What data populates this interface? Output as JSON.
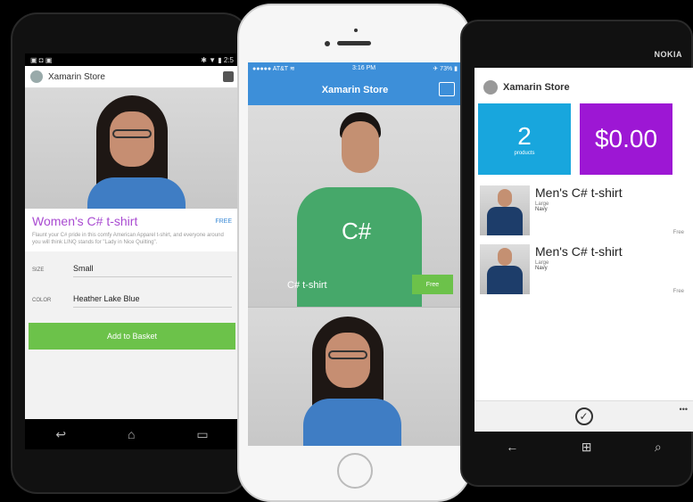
{
  "android": {
    "status": {
      "left": "▣ ◘ ▣",
      "right": "✱ ▼ ▮ 2:5"
    },
    "app_title": "Xamarin Store",
    "product_name": "Women's C# t-shirt",
    "price": "FREE",
    "description": "Flaunt your C# pride in this comfy American Apparel t-shirt, and everyone around you will think LINQ stands for \"Lady in Nice Quilting\".",
    "size_label": "SIZE",
    "size_value": "Small",
    "color_label": "COLOR",
    "color_value": "Heather Lake Blue",
    "add_button": "Add to Basket",
    "nav": {
      "back": "↩",
      "home": "⌂",
      "recent": "▭"
    }
  },
  "iphone": {
    "status": {
      "carrier": "●●●●● AT&T ≋",
      "time": "3:16 PM",
      "battery": "✈ 73% ▮"
    },
    "app_title": "Xamarin Store",
    "card1_logo": "C#",
    "card1_caption": "C# t-shirt",
    "card1_price": "Free"
  },
  "nokia": {
    "brand": "NOKIA",
    "app_title": "Xamarin Store",
    "items_count": "2",
    "items_label": "products",
    "total": "$0.00",
    "cart_items": [
      {
        "name": "Men's C# t-shirt",
        "size": "Large",
        "color": "Navy",
        "price": "Free"
      },
      {
        "name": "Men's C# t-shirt",
        "size": "Large",
        "color": "Navy",
        "price": "Free"
      }
    ],
    "appbar_check": "✓",
    "appbar_more": "•••",
    "nav": {
      "back": "←",
      "start": "⊞",
      "search": "⌕"
    }
  }
}
